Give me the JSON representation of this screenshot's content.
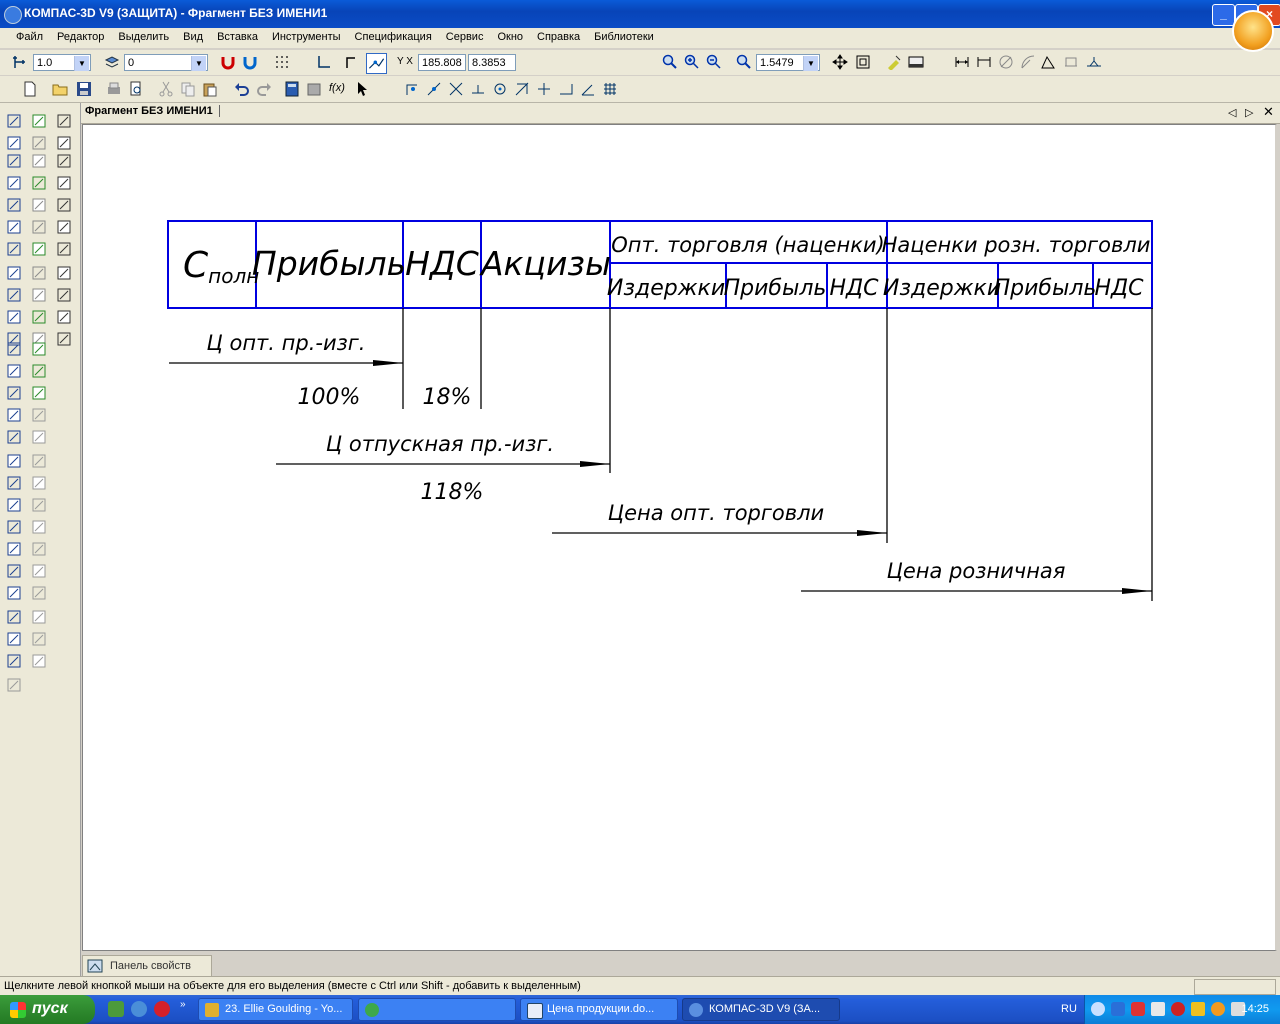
{
  "window": {
    "title": "КОМПАС-3D V9 (ЗАЩИТА) - Фрагмент БЕЗ ИМЕНИ1"
  },
  "menu": [
    "Файл",
    "Редактор",
    "Выделить",
    "Вид",
    "Вставка",
    "Инструменты",
    "Спецификация",
    "Сервис",
    "Окно",
    "Справка",
    "Библиотеки"
  ],
  "toolbar": {
    "step": "1.0",
    "layer": "0",
    "coord_x": "185.808",
    "coord_y": "8.3853",
    "coord_label": "Y X",
    "zoom": "1.5479",
    "func_label": "f(x)"
  },
  "document": {
    "tab": "Фрагмент БЕЗ ИМЕНИ1"
  },
  "drawing": {
    "headers": {
      "c_poln_main": "С",
      "c_poln_sub": "полн",
      "profit": "Прибыль",
      "vat": "НДС",
      "excise": "Акцизы",
      "wholesale": "Опт. торговля (наценки)",
      "retail": "Наценки розн. торговли",
      "costs1": "Издержки",
      "profit1": "Прибыль",
      "vat1": "НДС",
      "costs2": "Издержки",
      "profit2": "Прибыль",
      "vat2": "НДС"
    },
    "annotations": {
      "wholesale_mfr": "Ц опт. пр.-изг.",
      "pct100": "100%",
      "pct18": "18%",
      "release_mfr": "Ц отпускная пр.-изг.",
      "pct118": "118%",
      "wholesale_price": "Цена опт. торговли",
      "retail_price": "Цена розничная"
    }
  },
  "properties_panel": {
    "label": "Панель свойств"
  },
  "status": {
    "message": "Щелкните левой кнопкой мыши на объекте для его выделения (вместе с Ctrl или Shift - добавить к выделенным)"
  },
  "taskbar": {
    "start": "пуск",
    "tasks": [
      "23. Ellie Goulding - Yo...",
      "Цена продукции.do...",
      "КОМПАС-3D V9 (ЗА..."
    ],
    "lang": "RU",
    "clock": "14:25"
  }
}
